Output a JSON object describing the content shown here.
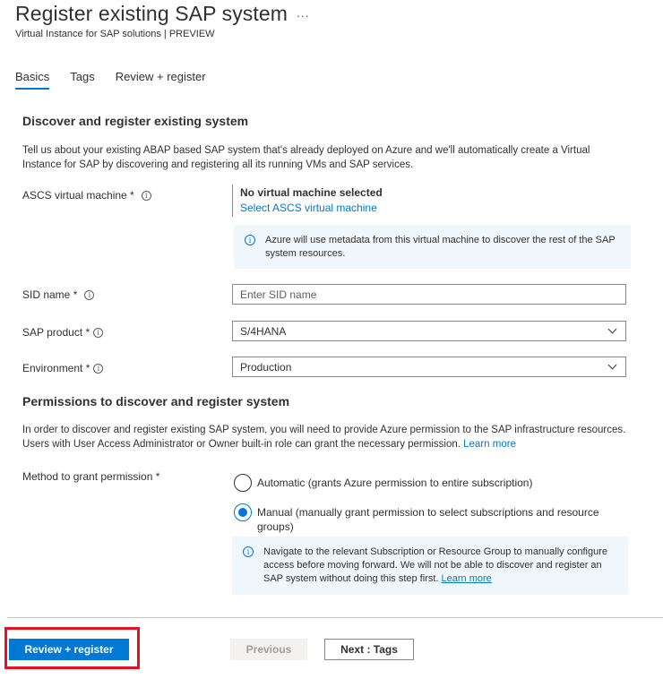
{
  "header": {
    "title": "Register existing SAP system",
    "more": "...",
    "subtitle": "Virtual Instance for SAP solutions | PREVIEW"
  },
  "tabs": [
    {
      "label": "Basics",
      "active": true
    },
    {
      "label": "Tags",
      "active": false
    },
    {
      "label": "Review + register",
      "active": false
    }
  ],
  "discover": {
    "title": "Discover and register existing system",
    "description": "Tell us about your existing ABAP based SAP system that's already deployed on Azure and we'll automatically create a Virtual Instance for SAP by discovering and registering all its running VMs and SAP services.",
    "ascs_label": "ASCS virtual machine *",
    "vm_none": "No virtual machine selected",
    "vm_select": "Select ASCS virtual machine",
    "vm_info": "Azure will use metadata from this virtual machine to discover the rest of the SAP system resources.",
    "sid_label": "SID name *",
    "sid_placeholder": "Enter SID name",
    "product_label": "SAP product *",
    "product_value": "S/4HANA",
    "environment_label": "Environment *",
    "environment_value": "Production"
  },
  "permissions": {
    "title": "Permissions to discover and register system",
    "description": "In order to discover and register existing SAP system, you will need to provide Azure permission to the SAP infrastructure resources. Users with User Access Administrator or Owner built-in role can grant the necessary permission.",
    "learn_more": "Learn more",
    "method_label": "Method to grant permission *",
    "options": [
      {
        "label": "Automatic (grants Azure permission to entire subscription)",
        "checked": false
      },
      {
        "label": "Manual (manually grant permission to select subscriptions and resource groups)",
        "checked": true
      }
    ],
    "manual_info": "Navigate to the relevant Subscription or Resource Group to manually configure access before moving forward. We will not be able to discover and register an SAP system without doing this step first.",
    "manual_learn_more": "Learn more"
  },
  "footer": {
    "review_register": "Review + register",
    "previous": "Previous",
    "next": "Next : Tags"
  },
  "colors": {
    "accent": "#0078d4",
    "highlight": "#e81123",
    "info_bg": "#eff6fc"
  },
  "icons": {
    "info": "info-icon",
    "more": "more-icon",
    "chevron": "chevron-down-icon"
  }
}
